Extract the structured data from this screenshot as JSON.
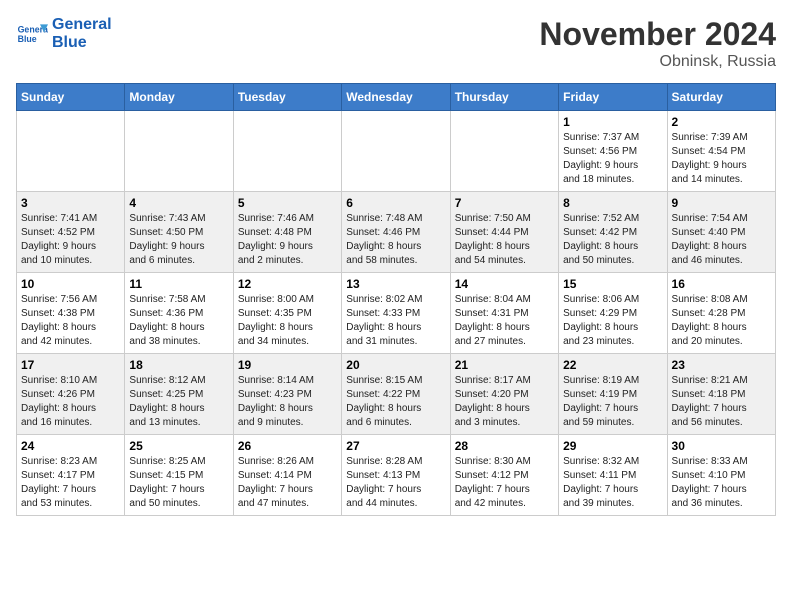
{
  "header": {
    "logo_line1": "General",
    "logo_line2": "Blue",
    "month": "November 2024",
    "location": "Obninsk, Russia"
  },
  "weekdays": [
    "Sunday",
    "Monday",
    "Tuesday",
    "Wednesday",
    "Thursday",
    "Friday",
    "Saturday"
  ],
  "weeks": [
    [
      {
        "day": "",
        "info": ""
      },
      {
        "day": "",
        "info": ""
      },
      {
        "day": "",
        "info": ""
      },
      {
        "day": "",
        "info": ""
      },
      {
        "day": "",
        "info": ""
      },
      {
        "day": "1",
        "info": "Sunrise: 7:37 AM\nSunset: 4:56 PM\nDaylight: 9 hours\nand 18 minutes."
      },
      {
        "day": "2",
        "info": "Sunrise: 7:39 AM\nSunset: 4:54 PM\nDaylight: 9 hours\nand 14 minutes."
      }
    ],
    [
      {
        "day": "3",
        "info": "Sunrise: 7:41 AM\nSunset: 4:52 PM\nDaylight: 9 hours\nand 10 minutes."
      },
      {
        "day": "4",
        "info": "Sunrise: 7:43 AM\nSunset: 4:50 PM\nDaylight: 9 hours\nand 6 minutes."
      },
      {
        "day": "5",
        "info": "Sunrise: 7:46 AM\nSunset: 4:48 PM\nDaylight: 9 hours\nand 2 minutes."
      },
      {
        "day": "6",
        "info": "Sunrise: 7:48 AM\nSunset: 4:46 PM\nDaylight: 8 hours\nand 58 minutes."
      },
      {
        "day": "7",
        "info": "Sunrise: 7:50 AM\nSunset: 4:44 PM\nDaylight: 8 hours\nand 54 minutes."
      },
      {
        "day": "8",
        "info": "Sunrise: 7:52 AM\nSunset: 4:42 PM\nDaylight: 8 hours\nand 50 minutes."
      },
      {
        "day": "9",
        "info": "Sunrise: 7:54 AM\nSunset: 4:40 PM\nDaylight: 8 hours\nand 46 minutes."
      }
    ],
    [
      {
        "day": "10",
        "info": "Sunrise: 7:56 AM\nSunset: 4:38 PM\nDaylight: 8 hours\nand 42 minutes."
      },
      {
        "day": "11",
        "info": "Sunrise: 7:58 AM\nSunset: 4:36 PM\nDaylight: 8 hours\nand 38 minutes."
      },
      {
        "day": "12",
        "info": "Sunrise: 8:00 AM\nSunset: 4:35 PM\nDaylight: 8 hours\nand 34 minutes."
      },
      {
        "day": "13",
        "info": "Sunrise: 8:02 AM\nSunset: 4:33 PM\nDaylight: 8 hours\nand 31 minutes."
      },
      {
        "day": "14",
        "info": "Sunrise: 8:04 AM\nSunset: 4:31 PM\nDaylight: 8 hours\nand 27 minutes."
      },
      {
        "day": "15",
        "info": "Sunrise: 8:06 AM\nSunset: 4:29 PM\nDaylight: 8 hours\nand 23 minutes."
      },
      {
        "day": "16",
        "info": "Sunrise: 8:08 AM\nSunset: 4:28 PM\nDaylight: 8 hours\nand 20 minutes."
      }
    ],
    [
      {
        "day": "17",
        "info": "Sunrise: 8:10 AM\nSunset: 4:26 PM\nDaylight: 8 hours\nand 16 minutes."
      },
      {
        "day": "18",
        "info": "Sunrise: 8:12 AM\nSunset: 4:25 PM\nDaylight: 8 hours\nand 13 minutes."
      },
      {
        "day": "19",
        "info": "Sunrise: 8:14 AM\nSunset: 4:23 PM\nDaylight: 8 hours\nand 9 minutes."
      },
      {
        "day": "20",
        "info": "Sunrise: 8:15 AM\nSunset: 4:22 PM\nDaylight: 8 hours\nand 6 minutes."
      },
      {
        "day": "21",
        "info": "Sunrise: 8:17 AM\nSunset: 4:20 PM\nDaylight: 8 hours\nand 3 minutes."
      },
      {
        "day": "22",
        "info": "Sunrise: 8:19 AM\nSunset: 4:19 PM\nDaylight: 7 hours\nand 59 minutes."
      },
      {
        "day": "23",
        "info": "Sunrise: 8:21 AM\nSunset: 4:18 PM\nDaylight: 7 hours\nand 56 minutes."
      }
    ],
    [
      {
        "day": "24",
        "info": "Sunrise: 8:23 AM\nSunset: 4:17 PM\nDaylight: 7 hours\nand 53 minutes."
      },
      {
        "day": "25",
        "info": "Sunrise: 8:25 AM\nSunset: 4:15 PM\nDaylight: 7 hours\nand 50 minutes."
      },
      {
        "day": "26",
        "info": "Sunrise: 8:26 AM\nSunset: 4:14 PM\nDaylight: 7 hours\nand 47 minutes."
      },
      {
        "day": "27",
        "info": "Sunrise: 8:28 AM\nSunset: 4:13 PM\nDaylight: 7 hours\nand 44 minutes."
      },
      {
        "day": "28",
        "info": "Sunrise: 8:30 AM\nSunset: 4:12 PM\nDaylight: 7 hours\nand 42 minutes."
      },
      {
        "day": "29",
        "info": "Sunrise: 8:32 AM\nSunset: 4:11 PM\nDaylight: 7 hours\nand 39 minutes."
      },
      {
        "day": "30",
        "info": "Sunrise: 8:33 AM\nSunset: 4:10 PM\nDaylight: 7 hours\nand 36 minutes."
      }
    ]
  ]
}
